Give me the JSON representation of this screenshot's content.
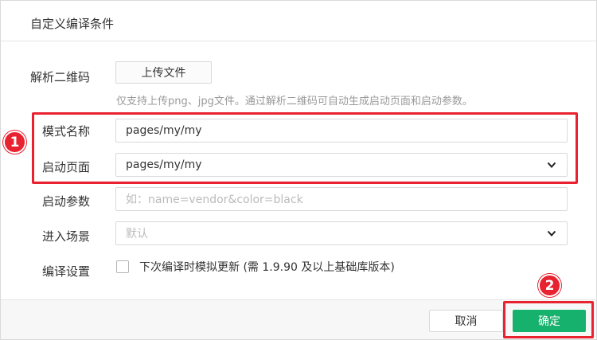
{
  "dialog": {
    "title": "自定义编译条件"
  },
  "qr": {
    "label": "解析二维码",
    "upload_label": "上传文件",
    "hint": "仅支持上传png、jpg文件。通过解析二维码可自动生成启动页面和启动参数。"
  },
  "mode_name": {
    "label": "模式名称",
    "value": "pages/my/my"
  },
  "start_page": {
    "label": "启动页面",
    "value": "pages/my/my"
  },
  "start_params": {
    "label": "启动参数",
    "placeholder": "如：name=vendor&color=black"
  },
  "scene": {
    "label": "进入场景",
    "placeholder": "默认"
  },
  "compile_settings": {
    "label": "编译设置",
    "checkbox_label": "下次编译时模拟更新 (需 1.9.90 及以上基础库版本)"
  },
  "footer": {
    "cancel_label": "取消",
    "ok_label": "确定"
  },
  "annotations": {
    "marker_1": "1",
    "marker_2": "2"
  },
  "colors": {
    "accent_green": "#16b16d",
    "annotation_red": "#e8222f"
  },
  "icons": [
    "chevron-down-icon"
  ]
}
